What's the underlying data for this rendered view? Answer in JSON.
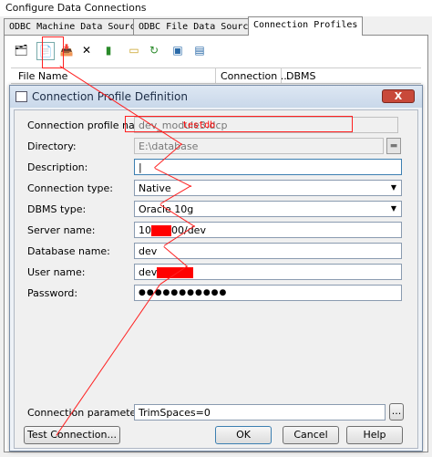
{
  "window": {
    "title": "Configure Data Connections"
  },
  "tabs": [
    {
      "label": "ODBC Machine Data Sources"
    },
    {
      "label": "ODBC File Data Sources"
    },
    {
      "label": "Connection Profiles"
    }
  ],
  "list": {
    "columns": [
      "File Name",
      "Connection ...",
      "DBMS"
    ]
  },
  "dialog": {
    "title": "Connection Profile Definition",
    "close_label": "X",
    "fields": {
      "profile_name_label": "Connection profile name:",
      "profile_name_value": "dev_module3.dcp",
      "directory_label": "Directory:",
      "directory_value": "E:\\database",
      "description_label": "Description:",
      "description_value": "|",
      "connection_type_label": "Connection type:",
      "connection_type_value": "Native",
      "dbms_type_label": "DBMS type:",
      "dbms_type_value": "Oracle 10g",
      "server_name_label": "Server name:",
      "server_name_prefix": "10",
      "server_name_suffix": "00/dev",
      "database_name_label": "Database name:",
      "database_name_value": "dev",
      "user_name_label": "User name:",
      "user_name_prefix": "dev",
      "password_label": "Password:",
      "password_value": "●●●●●●●●●●●",
      "connection_params_label": "Connection parameters:",
      "connection_params_value": "TrimSpaces=0",
      "browse_label": "...",
      "annotation": "testdb"
    },
    "buttons": {
      "test": "Test Connection...",
      "ok": "OK",
      "cancel": "Cancel",
      "help": "Help"
    }
  },
  "colors": {
    "annotation": "#ff0000",
    "titlebar": "#c9d8ea",
    "close": "#c8493a"
  }
}
